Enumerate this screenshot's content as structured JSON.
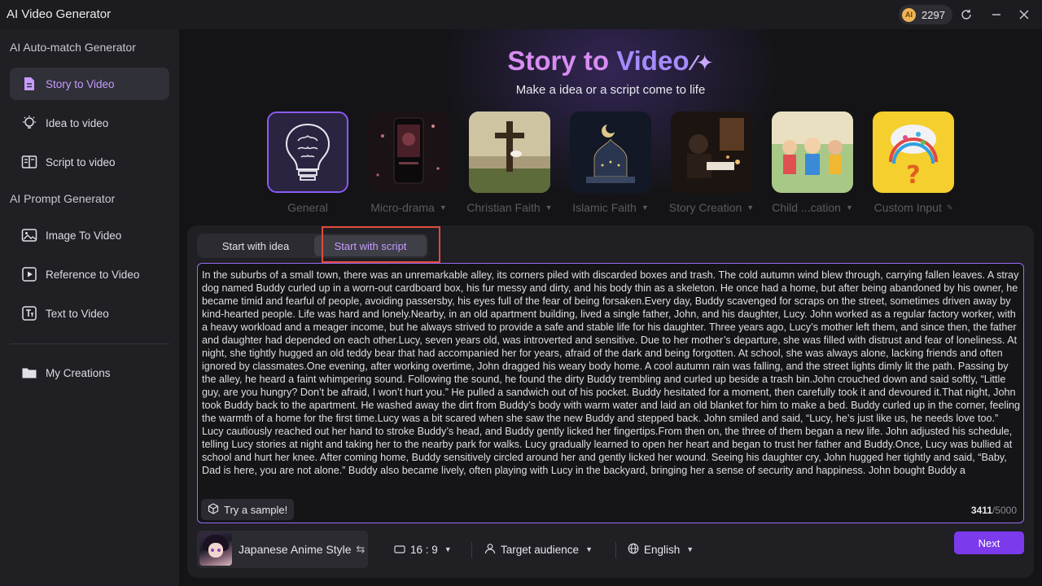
{
  "app": {
    "title": "AI Video Generator",
    "credits": "2297",
    "coin_label": "AI"
  },
  "titlebar_icons": [
    "refresh-icon",
    "minimize-icon",
    "close-icon"
  ],
  "sidebar": {
    "section1": "AI Auto-match Generator",
    "section2": "AI Prompt Generator",
    "items": [
      {
        "label": "Story to Video",
        "icon": "document-icon",
        "active": true
      },
      {
        "label": "Idea to video",
        "icon": "lightbulb-icon"
      },
      {
        "label": "Script to video",
        "icon": "script-book-icon"
      },
      {
        "label": "Image To Video",
        "icon": "image-icon"
      },
      {
        "label": "Reference to Video",
        "icon": "reference-video-icon"
      },
      {
        "label": "Text to Video",
        "icon": "text-icon"
      },
      {
        "label": "My Creations",
        "icon": "folder-icon"
      }
    ]
  },
  "hero": {
    "title_part1": "Story to ",
    "title_part2": "Video",
    "subtitle": "Make a idea or a script come to life"
  },
  "categories": [
    {
      "label": "General",
      "has_dropdown": false
    },
    {
      "label": "Micro-drama",
      "has_dropdown": true
    },
    {
      "label": "Christian Faith",
      "has_dropdown": true
    },
    {
      "label": "Islamic Faith",
      "has_dropdown": true
    },
    {
      "label": "Story Creation",
      "has_dropdown": true
    },
    {
      "label": "Child ...cation",
      "has_dropdown": true
    },
    {
      "label": "Custom Input",
      "has_dropdown": false
    }
  ],
  "tabs": [
    {
      "label": "Start with idea",
      "active": false
    },
    {
      "label": "Start with script",
      "active": true
    }
  ],
  "script": {
    "text": "In the suburbs of a small town, there was an unremarkable alley, its corners piled with discarded boxes and trash. The cold autumn wind blew through, carrying fallen leaves. A stray dog named Buddy curled up in a worn-out cardboard box, his fur messy and dirty, and his body thin as a skeleton. He once had a home, but after being abandoned by his owner, he became timid and fearful of people, avoiding passersby, his eyes full of the fear of being forsaken.Every day, Buddy scavenged for scraps on the street, sometimes driven away by kind-hearted people. Life was hard and lonely.Nearby, in an old apartment building, lived a single father, John, and his daughter, Lucy. John worked as a regular factory worker, with a heavy workload and a meager income, but he always strived to provide a safe and stable life for his daughter. Three years ago, Lucy’s mother left them, and since then, the father and daughter had depended on each other.Lucy, seven years old, was introverted and sensitive. Due to her mother’s departure, she was filled with distrust and fear of loneliness. At night, she tightly hugged an old teddy bear that had accompanied her for years, afraid of the dark and being forgotten. At school, she was always alone, lacking friends and often ignored by classmates.One evening, after working overtime, John dragged his weary body home. A cool autumn rain was falling, and the street lights dimly lit the path. Passing by the alley, he heard a faint whimpering sound. Following the sound, he found the dirty Buddy trembling and curled up beside a trash bin.John crouched down and said softly, “Little guy, are you hungry? Don’t be afraid, I won’t hurt you.” He pulled a sandwich out of his pocket. Buddy hesitated for a moment, then carefully took it and devoured it.That night, John took Buddy back to the apartment. He washed away the dirt from Buddy’s body with warm water and laid an old blanket for him to make a bed. Buddy curled up in the corner, feeling the warmth of a home for the first time.Lucy was a bit scared when she saw the new Buddy and stepped back. John smiled and said, “Lucy, he’s just like us, he needs love too.” Lucy cautiously reached out her hand to stroke Buddy’s head, and Buddy gently licked her fingertips.From then on, the three of them began a new life. John adjusted his schedule, telling Lucy stories at night and taking her to the nearby park for walks. Lucy gradually learned to open her heart and began to trust her father and Buddy.Once, Lucy was bullied at school and hurt her knee. After coming home, Buddy sensitively circled around her and gently licked her wound. Seeing his daughter cry, John hugged her tightly and said, “Baby, Dad is here, you are not alone.” Buddy also became lively, often playing with Lucy in the backyard, bringing her a sense of security and happiness. John bought Buddy a",
    "try_sample": "Try a sample!",
    "count_current": "3411",
    "count_max": "/5000"
  },
  "bottom": {
    "style": "Japanese Anime Style",
    "ratio": "16 : 9",
    "audience": "Target audience",
    "language": "English",
    "next": "Next"
  },
  "colors": {
    "accent": "#7c3aed",
    "highlight_border": "#e24a3b",
    "active_text": "#c69cff"
  }
}
